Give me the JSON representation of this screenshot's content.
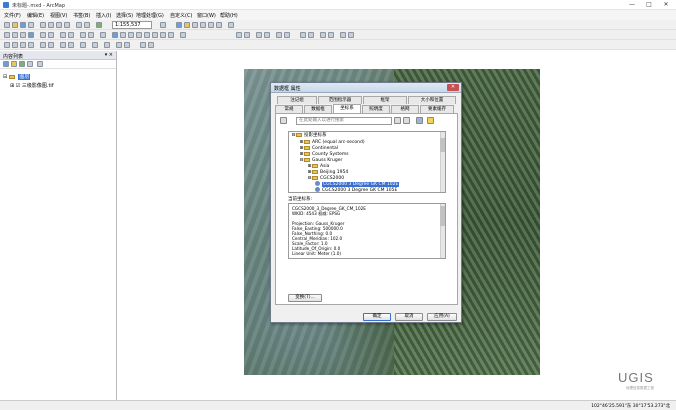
{
  "window": {
    "title": "未标题-.mxd - ArcMap",
    "minimize": "—",
    "maximize": "□",
    "close": "✕"
  },
  "menu": [
    "文件(F)",
    "编辑(E)",
    "视图(V)",
    "书签(B)",
    "插入(I)",
    "选择(S)",
    "地理处理(G)",
    "自定义(C)",
    "窗口(W)",
    "帮助(H)"
  ],
  "toolbar": {
    "scale": "1:155,537"
  },
  "toc": {
    "title": "内容列表",
    "controls": "▾ ×",
    "layers_label": "图层",
    "layer_item": "三级影像图.tif"
  },
  "dialog": {
    "title": "数据框 属性",
    "close": "✕",
    "tabs_row1": [
      "注记组",
      "范围指示器",
      "框架",
      "大小和位置"
    ],
    "tabs_row2": [
      "常规",
      "数据框",
      "坐标系",
      "照明度",
      "格网",
      "要素缓存"
    ],
    "search_placeholder": "在此处输入以进行搜索",
    "tree": [
      "投影坐标系",
      "ARC (equal arc-second)",
      "Continental",
      "County Systems",
      "Gauss Kruger",
      "Asia",
      "Beijing 1954",
      "CGCS2000",
      "CGCS2000 3 Degree GK CM 102E",
      "CGCS2000 3 Degree GK CM 105E"
    ],
    "current_label": "当前坐标系:",
    "details": [
      "CGCS2000_3_Degree_GK_CM_102E",
      "WKID: 4543 权威: EPSG",
      "",
      "Projection: Gauss_Kruger",
      "False_Easting: 500000.0",
      "False_Northing: 0.0",
      "Central_Meridian: 102.0",
      "Scale_Factor: 1.0",
      "Latitude_Of_Origin: 0.0",
      "Linear Unit: Meter (1.0)"
    ],
    "transform_button": "变换(T)...",
    "ok": "确定",
    "cancel": "取消",
    "apply": "应用(A)"
  },
  "status": {
    "coords": "102°46'25.591\"东  30°17'53.273\"北"
  },
  "watermark": {
    "logo": "UGIS",
    "sub": "地理信息数据工程"
  }
}
